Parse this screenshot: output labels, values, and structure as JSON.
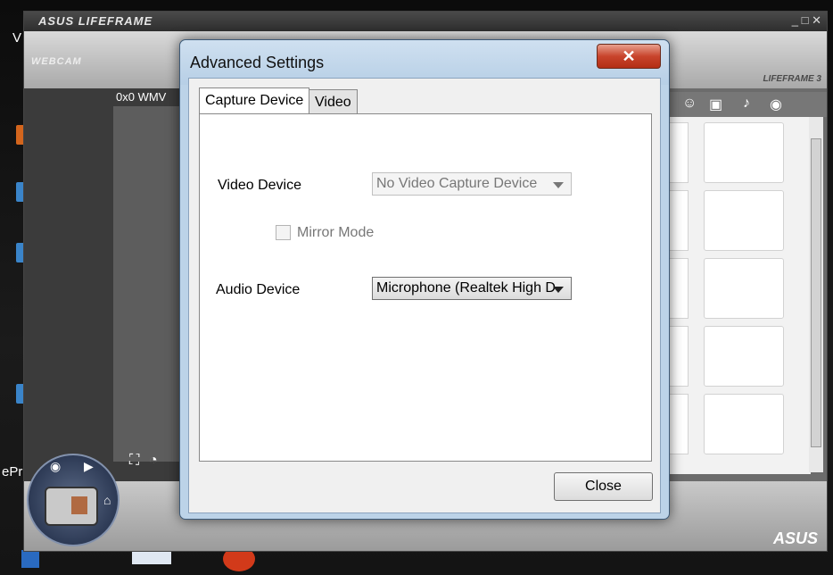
{
  "desktop": {
    "text_left_top": "V",
    "text_left_mid": "ePr"
  },
  "app": {
    "title": "ASUS LIFEFRAME",
    "window_controls": "_ □ ✕",
    "webcam_label": "WEBCAM",
    "brand_label": "LIFEFRAME 3",
    "resolution_label": "0x0  WMV",
    "footer_brand": "ASUS"
  },
  "dialog": {
    "title": "Advanced Settings",
    "close_x_glyph": "✕",
    "tabs": [
      {
        "label": "Capture Device",
        "active": true
      },
      {
        "label": "Video",
        "active": false
      }
    ],
    "video_device": {
      "label": "Video Device",
      "value": "No Video Capture Device",
      "enabled": false
    },
    "mirror_mode": {
      "label": "Mirror Mode",
      "checked": false,
      "enabled": false
    },
    "audio_device": {
      "label": "Audio Device",
      "value": "Microphone (Realtek High D",
      "enabled": true
    },
    "close_button": "Close"
  }
}
